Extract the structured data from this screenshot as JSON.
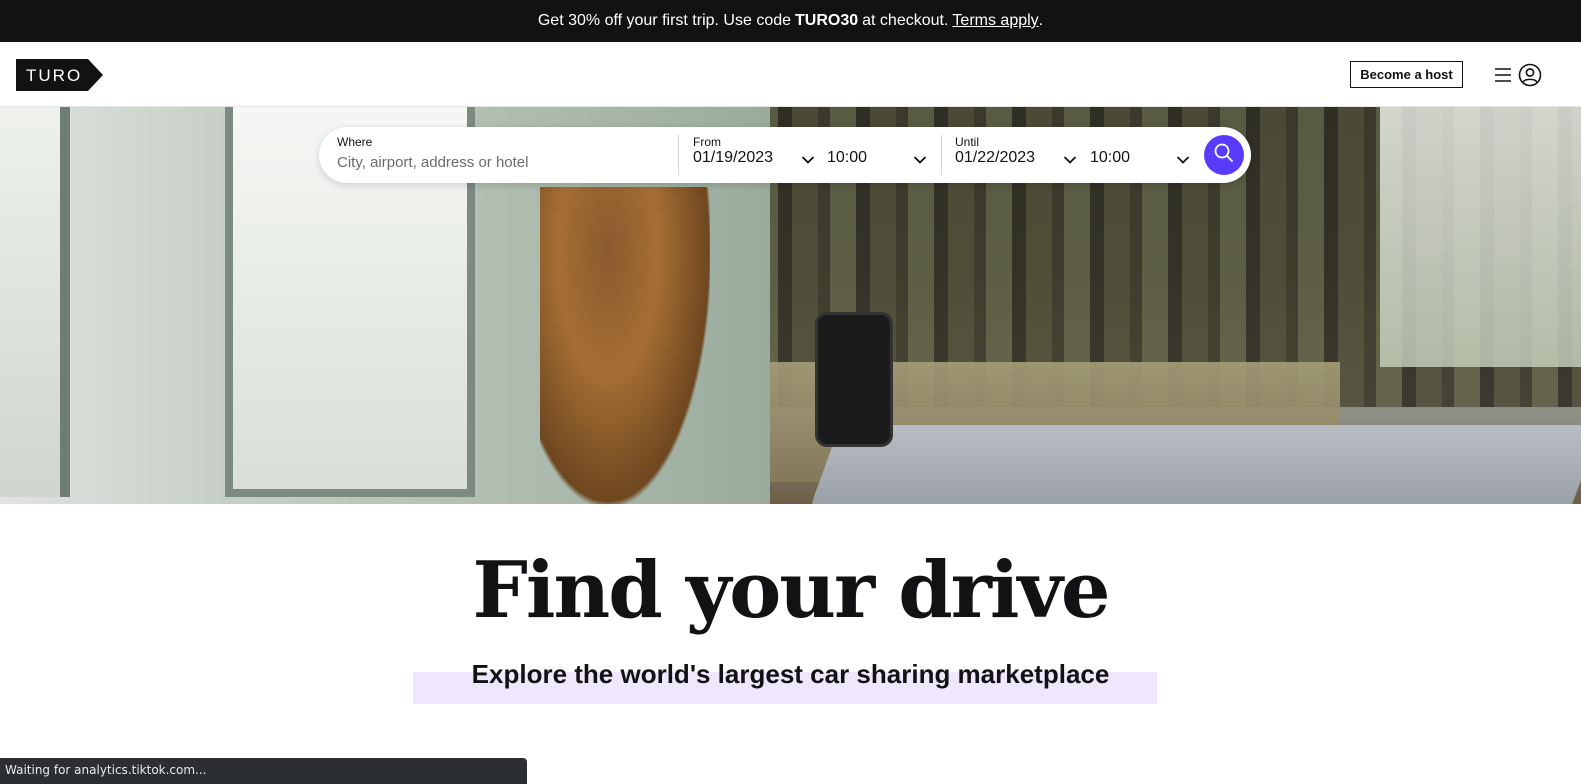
{
  "promo": {
    "text_before": "Get 30% off your first trip. Use code",
    "code": "TURO30",
    "text_after": "at checkout.",
    "link": "Terms apply",
    "end": "."
  },
  "header": {
    "logo_text": "TURO",
    "become_host_label": "Become a host",
    "menu_icon": "hamburger-icon",
    "account_icon": "user-circle-icon"
  },
  "search": {
    "where_label": "Where",
    "where_placeholder": "City, airport, address or hotel",
    "from_label": "From",
    "from_date": "01/19/2023",
    "from_time": "10:00",
    "until_label": "Until",
    "until_date": "01/22/2023",
    "until_time": "10:00",
    "search_icon": "search-icon"
  },
  "hero": {
    "headline": "Find your drive",
    "subheadline": "Explore the world's largest car sharing marketplace"
  },
  "status_bar": {
    "text": "Waiting for analytics.tiktok.com..."
  },
  "colors": {
    "brand_purple": "#593cfb",
    "banner_bg": "#121214",
    "highlight": "#efe8fd"
  }
}
